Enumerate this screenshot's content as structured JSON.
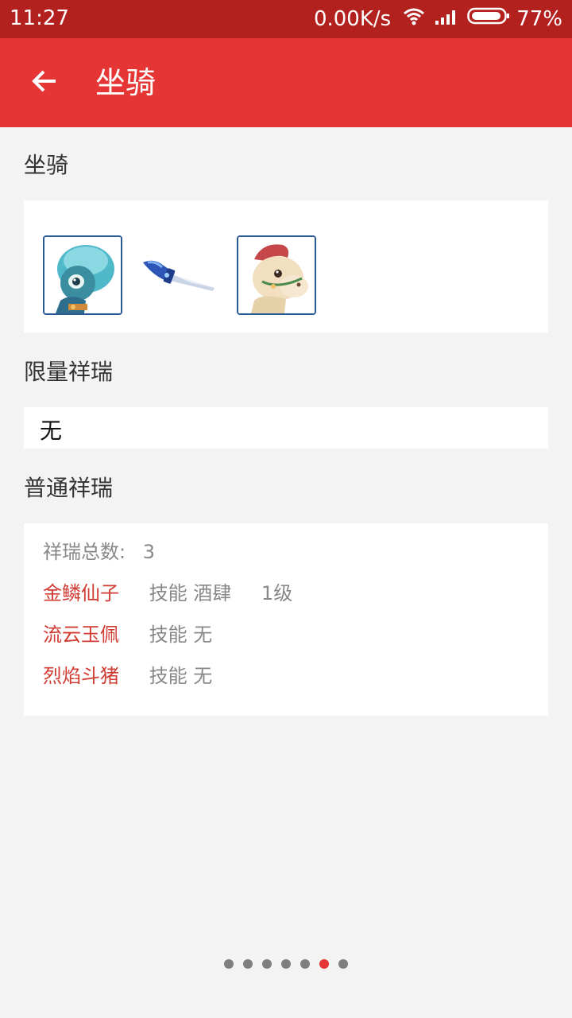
{
  "status_bar": {
    "time": "11:27",
    "speed": "0.00K/s",
    "battery": "77%",
    "icons": [
      "wifi-icon",
      "signal-icon",
      "battery-icon"
    ]
  },
  "header": {
    "title": "坐骑",
    "back_icon": "arrow-left-icon"
  },
  "mounts_section": {
    "title": "坐骑",
    "items": [
      {
        "icon": "blue-creature-mount-icon"
      },
      {
        "icon": "flying-sword-mount-icon"
      },
      {
        "icon": "horse-mount-icon"
      }
    ]
  },
  "limited_section": {
    "title": "限量祥瑞",
    "value": "无"
  },
  "normal_section": {
    "title": "普通祥瑞",
    "total_label": "祥瑞总数:",
    "total_value": "3",
    "items": [
      {
        "name": "金鳞仙子",
        "skill": "技能 酒肆",
        "level": "1级"
      },
      {
        "name": "流云玉佩",
        "skill": "技能 无",
        "level": ""
      },
      {
        "name": "烈焰斗猪",
        "skill": "技能 无",
        "level": ""
      }
    ]
  },
  "pager": {
    "count": 7,
    "active_index": 5
  },
  "colors": {
    "status_bar": "#b3211f",
    "app_bar": "#e53535",
    "accent_text": "#d03b32",
    "background": "#f3f3f3"
  }
}
